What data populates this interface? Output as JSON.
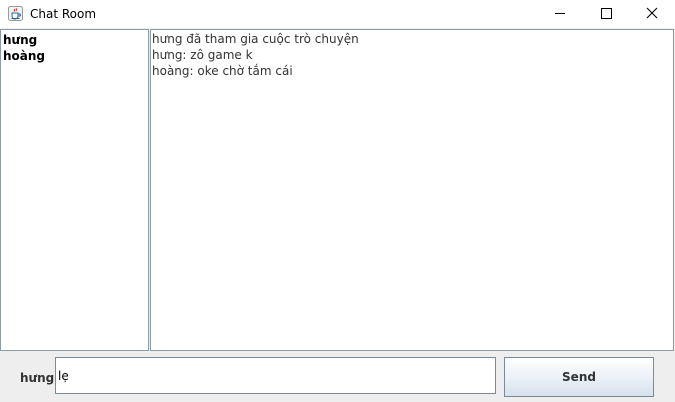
{
  "window": {
    "title": "Chat Room",
    "icon": "java-cup-icon"
  },
  "controls": {
    "minimize": "minimize-icon",
    "maximize": "maximize-icon",
    "close": "close-icon"
  },
  "users": [
    "hưng",
    "hoàng"
  ],
  "messages": [
    "hưng đã tham gia cuộc trò chuyện",
    "hưng: zô game k",
    "hoàng: oke chờ tắm cái"
  ],
  "composer": {
    "username": "hưng",
    "input_value": "lẹ",
    "send_label": "Send"
  },
  "colors": {
    "border": "#8d9ba8",
    "window_bg": "#eeeeee",
    "button_gradient_end": "#d6e1ec"
  }
}
